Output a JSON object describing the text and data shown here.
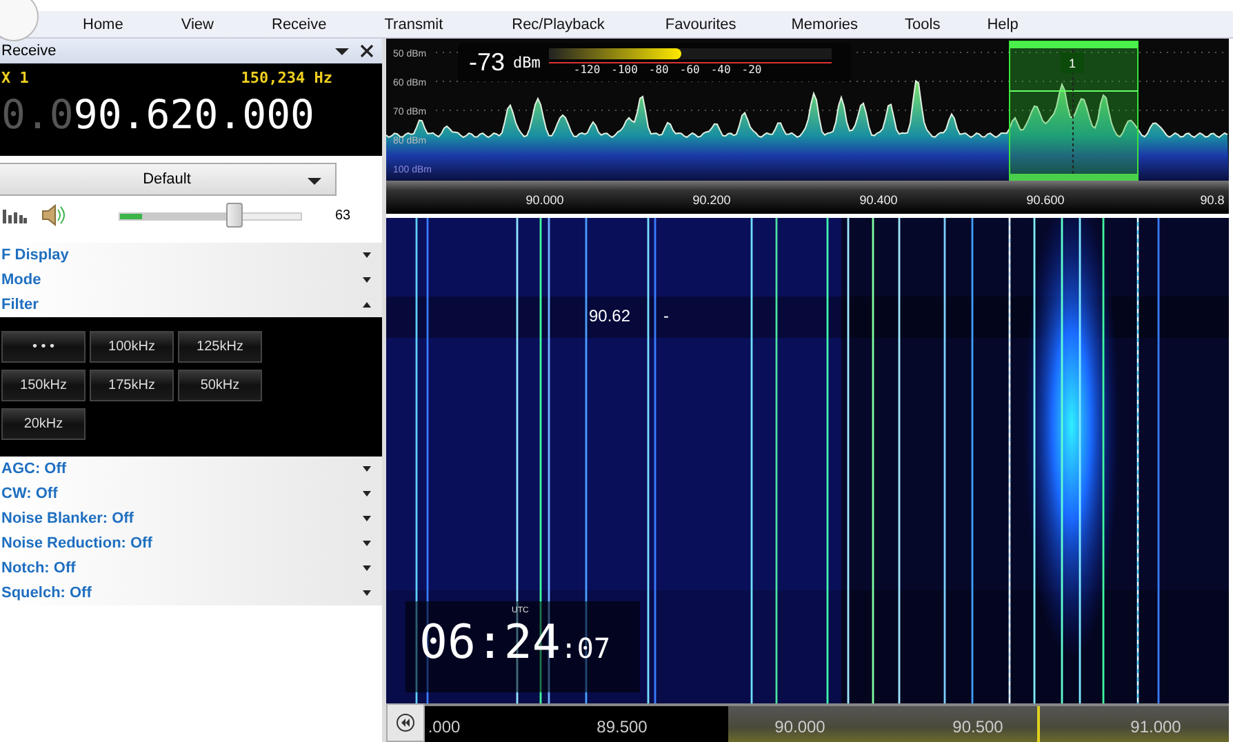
{
  "menu": [
    "Home",
    "View",
    "Receive",
    "Transmit",
    "Rec/Playback",
    "Favourites",
    "Memories",
    "Tools",
    "Help"
  ],
  "receive_panel": {
    "title": "Receive",
    "rx_label": "X 1",
    "offset": "150,234 Hz",
    "frequency_dim": "0.0",
    "frequency": "90.620.000",
    "preset": "Default",
    "volume": {
      "level": 0.63,
      "reading": "63"
    },
    "sections": [
      {
        "label": "F Display",
        "expanded": false
      },
      {
        "label": "Mode",
        "expanded": false
      },
      {
        "label": "Filter",
        "expanded": true,
        "buttons": [
          "• • •",
          "100kHz",
          "125kHz",
          "150kHz",
          "175kHz",
          "50kHz",
          "20kHz"
        ]
      },
      {
        "label": "AGC: Off",
        "expanded": false
      },
      {
        "label": "CW: Off",
        "expanded": false
      },
      {
        "label": "Noise Blanker: Off",
        "expanded": false
      },
      {
        "label": "Noise Reduction: Off",
        "expanded": false
      },
      {
        "label": "Notch: Off",
        "expanded": false
      },
      {
        "label": "Squelch: Off",
        "expanded": false
      }
    ]
  },
  "spectrum": {
    "db_labels": [
      "50 dBm",
      "60 dBm",
      "70 dBm",
      "80 dBm",
      "100 dBm"
    ],
    "meter": {
      "value": "-73",
      "unit": "dBm",
      "level": 0.47,
      "scale": [
        "-120",
        "-100",
        "-80",
        "-60",
        "-40",
        "-20"
      ]
    },
    "marker": "1",
    "freq_labels": [
      "90.000",
      "90.200",
      "90.400",
      "90.600",
      "90.8"
    ]
  },
  "waterfall": {
    "freq_tag": "90.62",
    "tag_suffix": "-",
    "clock": {
      "zone": "UTC",
      "time": "06:24",
      "seconds": ":07"
    }
  },
  "bottom_ruler": {
    "labels": [
      ".000",
      "89.500",
      "90.000",
      "90.500",
      "91.000"
    ]
  }
}
